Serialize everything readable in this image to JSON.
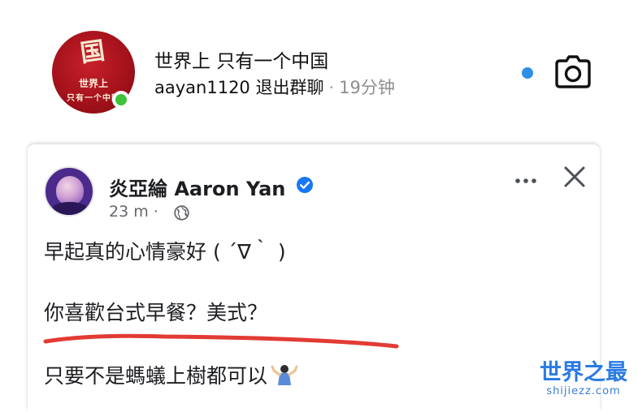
{
  "dm_thread": {
    "name": "世界上 只有一个中国",
    "last_message": "aayan1120 退出群聊",
    "separator": "·",
    "time_ago": "19分钟",
    "avatar_text_top": "世界上",
    "avatar_text_bottom": "只有一个中国",
    "avatar_seal": "国",
    "online": true,
    "unread": true
  },
  "post": {
    "author": "炎亞綸 Aaron Yan",
    "verified": true,
    "time": "23 m ·",
    "lines": [
      "早起真的心情豪好 ( ´∇｀ )",
      "你喜歡台式早餐？美式？",
      "只要不是螞蟻上樹都可以"
    ]
  },
  "watermark": {
    "title": "世界之最",
    "url": "shijiezz.com"
  },
  "colors": {
    "accent_blue": "#2d8fe8",
    "online_green": "#3ec23a",
    "verified_blue": "#1877f2",
    "underline_red": "#e23b34",
    "watermark_blue": "#2a7be4"
  },
  "icons": [
    "camera-icon",
    "verified-icon",
    "globe-icon",
    "more-icon",
    "close-icon",
    "shrug-icon"
  ]
}
